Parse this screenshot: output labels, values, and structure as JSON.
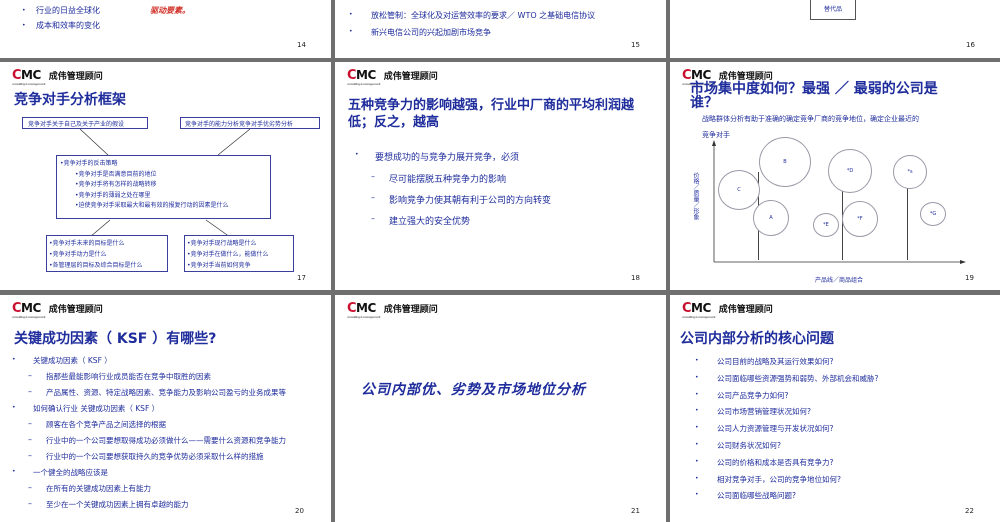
{
  "s14": {
    "page": "14",
    "bullets": [
      "行业的日益全球化",
      "成本和效率的变化"
    ],
    "red_text": "驱动要素。"
  },
  "s15": {
    "page": "15",
    "bullets": [
      "放松管制：全球化及对运营效率的要求／ WTO 之基础电信协议",
      "新兴电信公司的兴起加剧市场竞争"
    ]
  },
  "s16": {
    "page": "16",
    "box_text": "替代品"
  },
  "brand": {
    "name": "成伟管理顾问",
    "mark_prefix": "C",
    "mark_rest": "MC",
    "sub": "consulting & management"
  },
  "s17": {
    "page": "17",
    "title": "竞争对手分析框架",
    "top_left": "竞争对手关于自己及关于产业的假设",
    "top_right": "竞争对手的能力分析竞争对手优劣势分析",
    "center": [
      "•竞争对手的反击策略",
      "•竞争对手是否满意目前的地位",
      "•竞争对手将有怎样的战略转移",
      "•竞争对手的薄弱之处在哪里",
      "•迫使竞争对手采取最大和最有效的报复行动的因素是什么"
    ],
    "bottom_left": [
      "•竞争对手未来的目标是什么",
      "•竞争对手动力是什么",
      "•各管理层的目标及综合目标是什么"
    ],
    "bottom_right": [
      "•竞争对手现行战略是什么",
      "•竞争对手在做什么，能做什么",
      "•竞争对手当前如何竞争"
    ]
  },
  "s18": {
    "page": "18",
    "title_l1": "五种竞争力的影响越强，行业中厂商的平均利润越",
    "title_l2": "低；反之，越高",
    "main": "要想成功的与竞争力展开竞争，必须",
    "subs": [
      "尽可能摆脱五种竞争力的影响",
      "影响竞争力使其朝有利于公司的方向转变",
      "建立强大的安全优势"
    ]
  },
  "s19": {
    "page": "19",
    "title_l1": "市场集中度如何？最强 ／ 最弱的公司是",
    "title_l2": "谁？",
    "subtitle_l1": "战略群体分析有助于准确的确定竞争厂商的竞争地位，确定企业最近的",
    "subtitle_l2": "竞争对手",
    "ylabel": "价格／质量／形象",
    "xlabel": "产品线／商品组合",
    "bubbles": [
      "B",
      "C",
      "A",
      "*D",
      "*E",
      "*F",
      "*s",
      "*G"
    ]
  },
  "s20": {
    "page": "20",
    "title": "关键成功因素（ KSF ）有哪些?",
    "lines": [
      {
        "t": "b",
        "text": "关键成功因素（ KSF ）"
      },
      {
        "t": "d",
        "text": "指那些最能影响行业成员能否在竞争中取胜的因素"
      },
      {
        "t": "d",
        "text": "产品属性、资源、特定战略因素、竞争能力及影响公司盈亏的业务成果等"
      },
      {
        "t": "b",
        "text": "如何确认行业 关键成功因素（ KSF ）"
      },
      {
        "t": "d",
        "text": "顾客在各个竞争产品之间选择的根据"
      },
      {
        "t": "d",
        "text": "行业中的一个公司要想取得成功必须做什么——需要什么资源和竞争能力"
      },
      {
        "t": "d",
        "text": "行业中的一个公司要想获取持久的竞争优势必须采取什么样的措施"
      },
      {
        "t": "b",
        "text": "一个健全的战略应该是"
      },
      {
        "t": "d",
        "text": "在所有的关键成功因素上有能力"
      },
      {
        "t": "d",
        "text": "至少在一个关键成功因素上拥有卓越的能力"
      }
    ]
  },
  "s21": {
    "page": "21",
    "title": "公司内部优、劣势及市场地位分析"
  },
  "s22": {
    "page": "22",
    "title": "公司内部分析的核心问题",
    "items": [
      "公司目前的战略及其运行效果如何?",
      "公司面临哪些资源强势和弱势、外部机会和威胁?",
      "公司产品竞争力如何?",
      "公司市场营销管理状况如何?",
      "公司人力资源管理与开发状况如何?",
      "公司财务状况如何?",
      "公司的价格和成本是否具有竞争力?",
      "相对竞争对手，公司的竞争地位如何?",
      "公司面临哪些战略问题?"
    ]
  }
}
